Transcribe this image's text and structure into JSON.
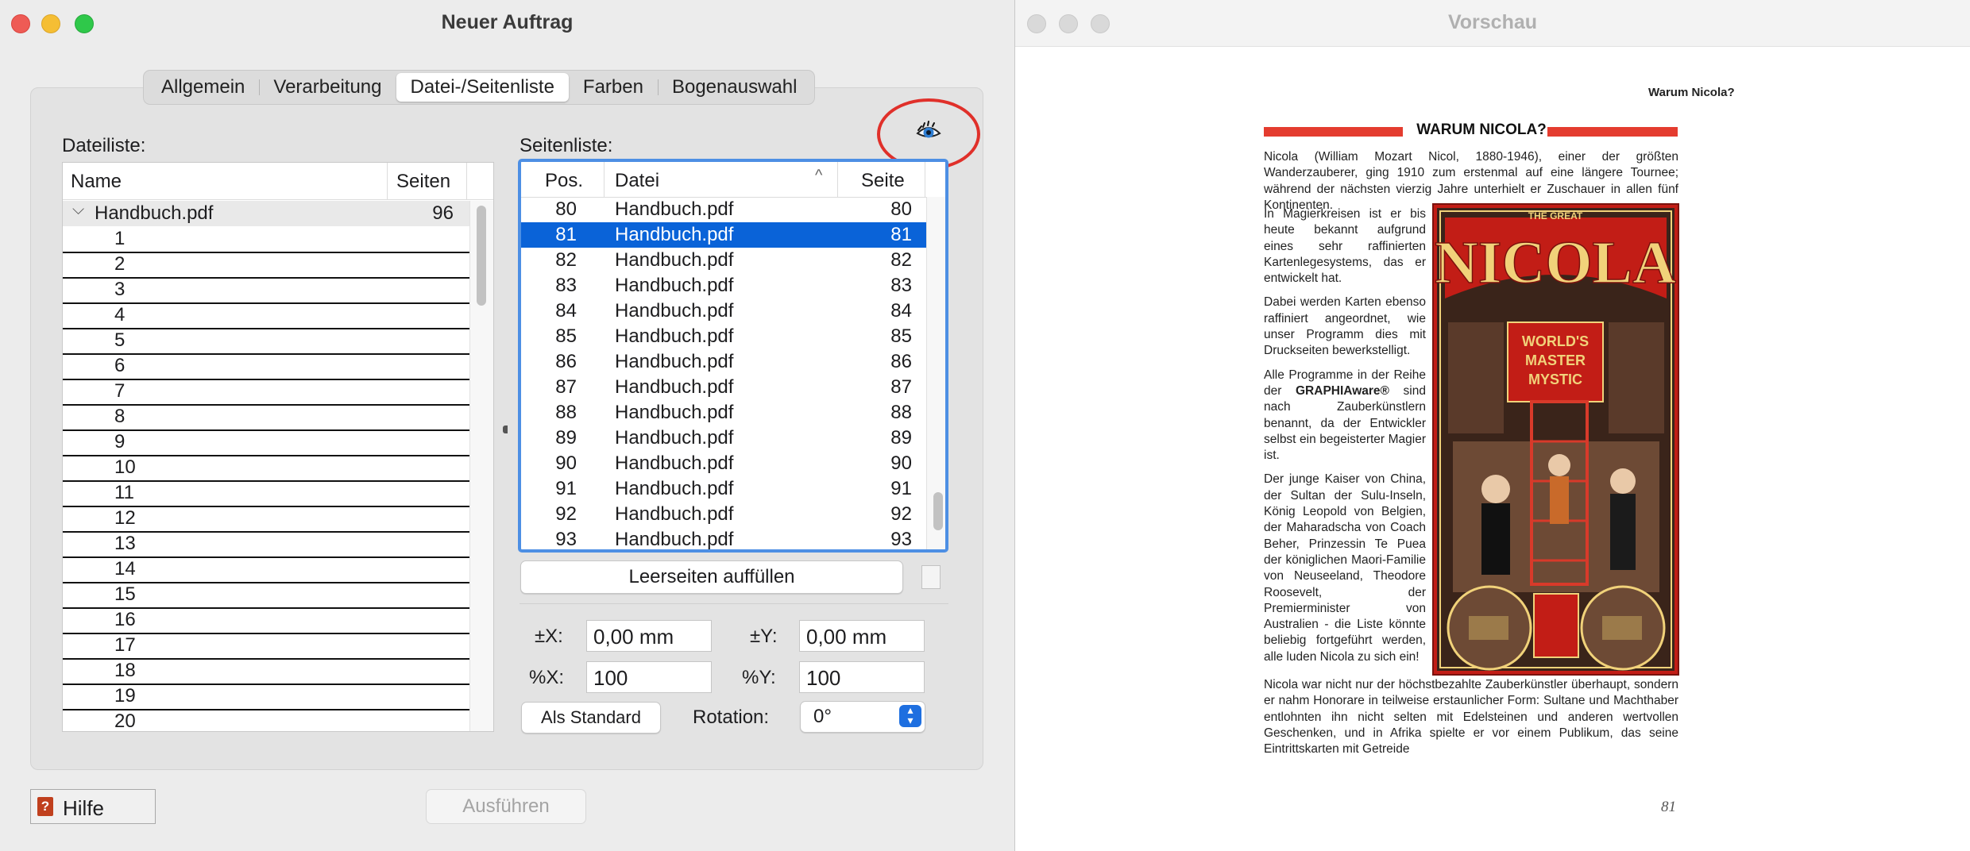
{
  "dialog": {
    "title": "Neuer Auftrag",
    "tabs": [
      "Allgemein",
      "Verarbeitung",
      "Datei-/Seitenliste",
      "Farben",
      "Bogenauswahl"
    ],
    "selected_tab": "Datei-/Seitenliste",
    "file_list": {
      "label": "Dateiliste:",
      "columns": [
        "Name",
        "Seiten"
      ],
      "file": {
        "name": "Handbuch.pdf",
        "pages": "96"
      },
      "page_items": [
        "1",
        "2",
        "3",
        "4",
        "5",
        "6",
        "7",
        "8",
        "9",
        "10",
        "11",
        "12",
        "13",
        "14",
        "15",
        "16",
        "17",
        "18",
        "19",
        "20"
      ]
    },
    "page_list": {
      "label": "Seitenliste:",
      "columns": [
        "Pos.",
        "Datei",
        "Seite"
      ],
      "rows": [
        {
          "pos": "80",
          "file": "Handbuch.pdf",
          "page": "80"
        },
        {
          "pos": "81",
          "file": "Handbuch.pdf",
          "page": "81"
        },
        {
          "pos": "82",
          "file": "Handbuch.pdf",
          "page": "82"
        },
        {
          "pos": "83",
          "file": "Handbuch.pdf",
          "page": "83"
        },
        {
          "pos": "84",
          "file": "Handbuch.pdf",
          "page": "84"
        },
        {
          "pos": "85",
          "file": "Handbuch.pdf",
          "page": "85"
        },
        {
          "pos": "86",
          "file": "Handbuch.pdf",
          "page": "86"
        },
        {
          "pos": "87",
          "file": "Handbuch.pdf",
          "page": "87"
        },
        {
          "pos": "88",
          "file": "Handbuch.pdf",
          "page": "88"
        },
        {
          "pos": "89",
          "file": "Handbuch.pdf",
          "page": "89"
        },
        {
          "pos": "90",
          "file": "Handbuch.pdf",
          "page": "90"
        },
        {
          "pos": "91",
          "file": "Handbuch.pdf",
          "page": "91"
        },
        {
          "pos": "92",
          "file": "Handbuch.pdf",
          "page": "92"
        },
        {
          "pos": "93",
          "file": "Handbuch.pdf",
          "page": "93"
        }
      ],
      "selected_pos": "81"
    },
    "fill_blank_button": "Leerseiten auffüllen",
    "offset_x_label": "±X:",
    "offset_x_value": "0,00 mm",
    "offset_y_label": "±Y:",
    "offset_y_value": "0,00 mm",
    "scale_x_label": "%X:",
    "scale_x_value": "100",
    "scale_y_label": "%Y:",
    "scale_y_value": "100",
    "default_button": "Als Standard",
    "rotation_label": "Rotation:",
    "rotation_value": "0°",
    "help_button": "Hilfe",
    "execute_button": "Ausführen",
    "colors": {
      "accent": "#0a63d8",
      "highlight_ring": "#e0302a",
      "focus_ring": "#4d8fe4"
    }
  },
  "preview": {
    "title": "Vorschau",
    "running_head": "Warum Nicola?",
    "heading": "WARUM NICOLA?",
    "intro": "Nicola (William Mozart Nicol, 1880-1946), einer der größten Wanderzauberer, ging 1910 zum erstenmal auf eine längere Tournee; während der nächsten vierzig Jahre unterhielt er Zuschauer in allen fünf Kontinenten.",
    "col_p1": "In Magierkreisen ist er bis heute bekannt aufgrund eines sehr raffinierten Kartenlegesystems, das er entwickelt hat.",
    "col_p2": "Dabei werden Karten ebenso raffiniert angeordnet, wie unser Programm dies mit Druckseiten bewerkstelligt.",
    "col_p3_a": "Alle Programme in der Reihe der ",
    "col_p3_brand": "GRAPHIAware®",
    "col_p3_b": " sind nach Zauberkünstlern benannt, da der Entwickler selbst ein begeisterter Magier ist.",
    "col_p4": "Der junge Kaiser von China, der Sultan der Sulu-Inseln, König Leopold von Belgien, der Maharadscha von Coach Beher, Prinzessin Te Puea der königlichen Maori-Familie von Neuseeland, Theodore Roosevelt, der Premierminister von Australien - die Liste könnte beliebig fortgeführt werden, alle luden Nicola zu sich ein!",
    "closing": "Nicola war nicht nur der höchstbezahlte Zauberkünstler überhaupt, sondern er nahm Honorare in teilweise erstaunlicher Form: Sultane und Machthaber entlohnten ihn nicht selten mit Edelsteinen und anderen wertvollen Geschenken, und in Afrika spielte er vor einem Publikum, das seine Eintrittskarten mit Getreide",
    "page_number": "81",
    "poster": {
      "top_text": "THE GREAT",
      "name": "NICOLA",
      "slogan_1": "WORLD'S",
      "slogan_2": "MASTER",
      "slogan_3": "MYSTIC",
      "colors": {
        "frame": "#c21d16",
        "gold": "#f1d27a",
        "dark": "#2a1a14"
      }
    }
  }
}
